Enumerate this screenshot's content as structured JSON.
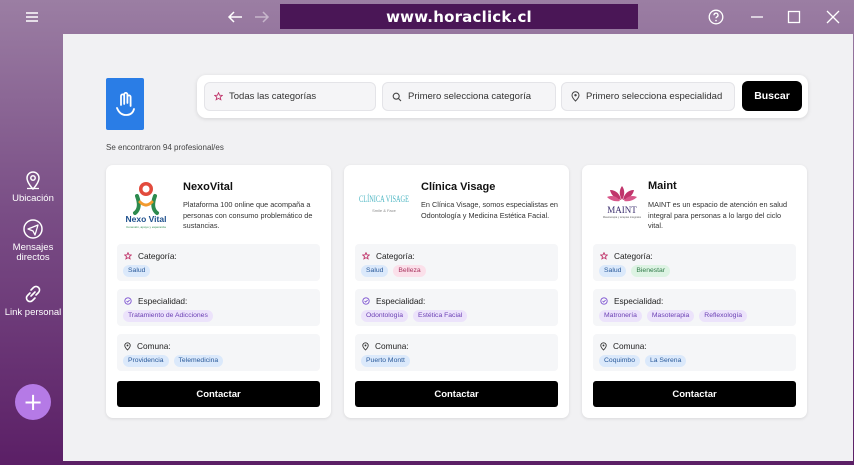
{
  "browser": {
    "url": "www.horaclick.cl"
  },
  "sidebar": {
    "items": [
      {
        "label": "Ubicación",
        "icon": "location-pin-icon"
      },
      {
        "label": "Mensajes directos",
        "icon": "paper-plane-icon"
      },
      {
        "label": "Link personal",
        "icon": "link-icon"
      }
    ],
    "fab_symbol": "+"
  },
  "search": {
    "category_value": "Todas las categorías",
    "specialty_placeholder": "Primero selecciona categoría",
    "specialty_placeholder_2": "Primero selecciona especialidad",
    "button": "Buscar"
  },
  "results_count": "Se encontraron 94 profesional/es",
  "labels": {
    "category": "Categoría:",
    "specialty": "Especialidad:",
    "comuna": "Comuna:",
    "contact": "Contactar"
  },
  "cards": [
    {
      "name": "NexoVital",
      "logo_text": "Nexo Vital",
      "logo_sub": "Conexión, apoyo y esperanza",
      "description": "Plataforma 100 online que acompaña a personas con consumo problemático de sustancias.",
      "categories": [
        "Salud"
      ],
      "specialties": [
        "Tratamiento de Adicciones"
      ],
      "comunas": [
        "Providencia",
        "Telemedicina"
      ]
    },
    {
      "name": "Clínica Visage",
      "logo_text": "CLÍNICA VISAGE",
      "logo_sub": "Smile & Face",
      "description": "En Clínica Visage, somos especialistas en Odontología y Medicina Estética Facial.",
      "categories": [
        "Salud",
        "Belleza"
      ],
      "specialties": [
        "Odontología",
        "Estética Facial"
      ],
      "comunas": [
        "Puerto Montt"
      ]
    },
    {
      "name": "Maint",
      "logo_text": "MAINT",
      "logo_sub": "Masoterapia y terapias integrales",
      "description": "MAINT es un espacio de atención en salud integral para personas a lo largo del ciclo vital.",
      "categories": [
        "Salud",
        "Bienestar"
      ],
      "specialties": [
        "Matronería",
        "Masoterapia",
        "Reflexología"
      ],
      "comunas": [
        "Coquimbo",
        "La Serena"
      ]
    }
  ],
  "colors": {
    "accent_purple": "#5b1f66",
    "fab": "#b57ae6",
    "logo_blue": "#2a7de6"
  }
}
